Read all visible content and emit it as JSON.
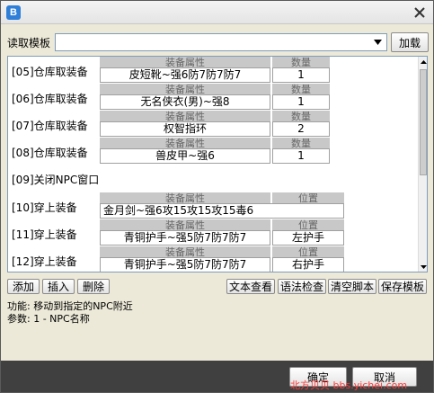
{
  "app_icon_glyph": "B",
  "template": {
    "label": "读取模板",
    "value": "",
    "load_button": "加载"
  },
  "rows": [
    {
      "label": "[05]仓库取装备",
      "hdr1": "装备属性",
      "hdr2": "数量",
      "val1": "皮短靴~强6防7防7防7",
      "val2": "1"
    },
    {
      "label": "[06]仓库取装备",
      "hdr1": "装备属性",
      "hdr2": "数量",
      "val1": "无名侠衣(男)~强8",
      "val2": "1"
    },
    {
      "label": "[07]仓库取装备",
      "hdr1": "装备属性",
      "hdr2": "数量",
      "val1": "权智指环",
      "val2": "2"
    },
    {
      "label": "[08]仓库取装备",
      "hdr1": "装备属性",
      "hdr2": "数量",
      "val1": "兽皮甲~强6",
      "val2": "1"
    },
    {
      "label": "[09]关闭NPC窗口"
    },
    {
      "label": "[10]穿上装备",
      "hdr1": "装备属性",
      "hdr2": "位置",
      "val1": "金月剑~强6攻15攻15攻15毒6",
      "val2": ""
    },
    {
      "label": "[11]穿上装备",
      "hdr1": "装备属性",
      "hdr2": "位置",
      "val1": "青铜护手~强5防7防7防7",
      "val2": "左护手"
    },
    {
      "label": "[12]穿上装备",
      "hdr1": "装备属性",
      "hdr2": "位置",
      "val1": "青铜护手~强5防7防7防7",
      "val2": "右护手"
    }
  ],
  "actions": {
    "add": "添加",
    "insert": "插入",
    "delete": "删除",
    "text_view": "文本查看",
    "syntax_check": "语法检查",
    "clear_script": "清空脚本",
    "save_template": "保存模板"
  },
  "description": {
    "function": "功能: 移动到指定的NPC附近",
    "params": "参数: 1 - NPC名称"
  },
  "footer": {
    "ok": "确定",
    "cancel": "取消",
    "watermark": "北方贝贝 bbs.yichei.com"
  },
  "colors": {
    "header_bg": "#c8c8c8",
    "bottom_bar": "#404040",
    "watermark": "#ff3b3b"
  }
}
